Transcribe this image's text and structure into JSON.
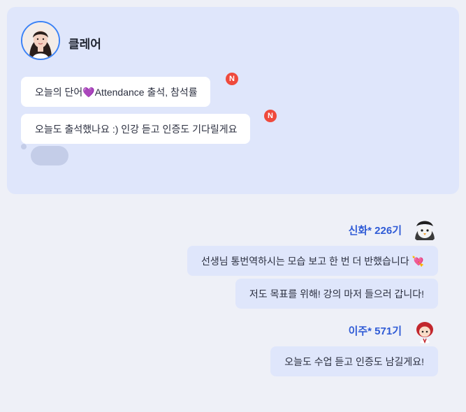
{
  "teacher": {
    "name": "클레어",
    "messages": [
      {
        "text": "오늘의 단어💜Attendance 출석, 참석률",
        "badge": "N"
      },
      {
        "text": "오늘도 출석했나요 :) 인강 듣고 인증도 기다릴게요",
        "badge": "N"
      }
    ]
  },
  "students": [
    {
      "name": "신화* 226기",
      "messages": [
        "선생님 통번역하시는 모습 보고 한 번 더 반했습니다 💘",
        "저도 목표를 위해! 강의 마저 들으러 갑니다!"
      ]
    },
    {
      "name": "이주* 571기",
      "messages": [
        "오늘도 수업 듣고 인증도 남길게요!"
      ]
    }
  ],
  "colors": {
    "teacher_card": "#dfe6fb",
    "badge": "#ef4a3c",
    "student_name": "#2f5bd6"
  }
}
